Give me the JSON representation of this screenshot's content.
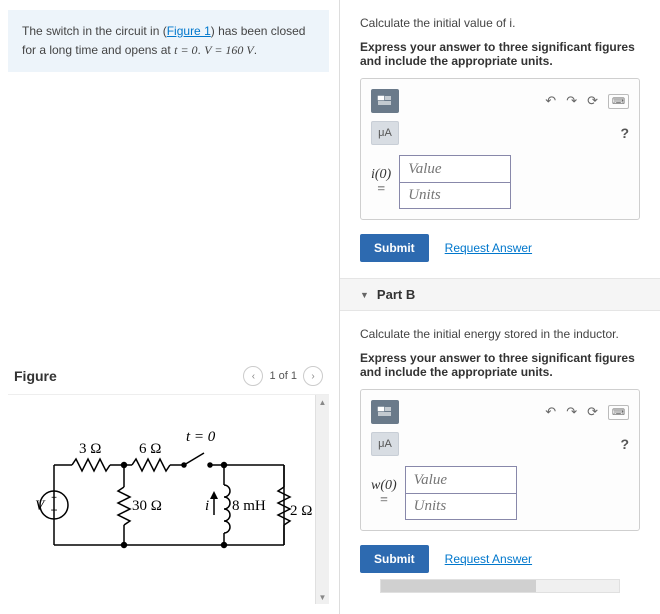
{
  "problem": {
    "text_before_link": "The switch in the circuit in (",
    "link_text": "Figure 1",
    "text_after_link": ") has been closed for a long time and opens at ",
    "eq1": "t = 0",
    "text_mid": ". ",
    "eq2": "V = 160 V",
    "text_end": "."
  },
  "figure": {
    "title": "Figure",
    "pager": "1 of 1",
    "labels": {
      "t0": "t = 0",
      "r3": "3 Ω",
      "r6": "6 Ω",
      "r30": "30 Ω",
      "l8": "8 mH",
      "r2": "2 Ω",
      "v": "V",
      "i": "i"
    }
  },
  "partA": {
    "prompt": "Calculate the initial value of i.",
    "instr": "Express your answer to three significant figures and include the appropriate units.",
    "var_html": "i(0)<br>=",
    "value_ph": "Value",
    "units_ph": "Units",
    "unit_btn": "μA"
  },
  "partB": {
    "header": "Part B",
    "prompt": "Calculate the initial energy stored in the inductor.",
    "instr": "Express your answer to three significant figures and include the appropriate units.",
    "var_html": "w(0)<br>=",
    "value_ph": "Value",
    "units_ph": "Units",
    "unit_btn": "μA"
  },
  "common": {
    "submit": "Submit",
    "request": "Request Answer",
    "help": "?"
  }
}
